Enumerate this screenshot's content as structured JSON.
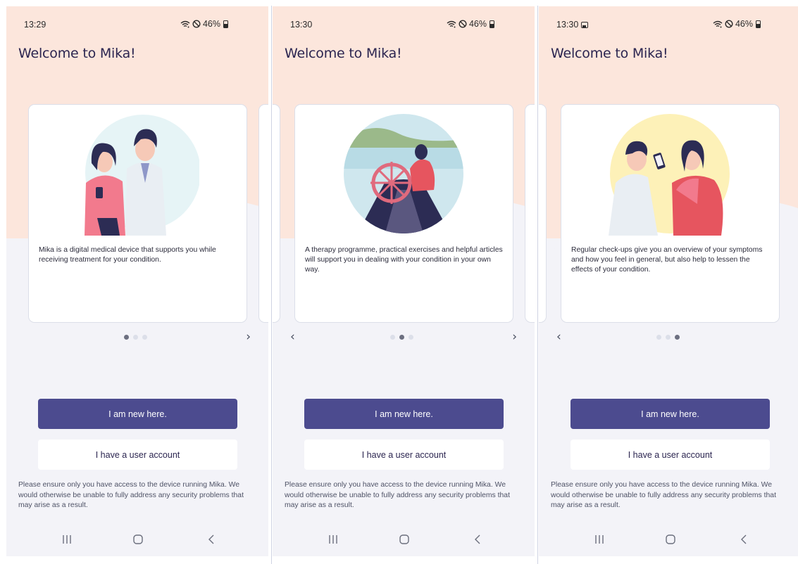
{
  "colors": {
    "peach": "#fce6dc",
    "background": "#f3f3f8",
    "primary_button": "#4c4b8f",
    "title": "#2b2550"
  },
  "screens": [
    {
      "status": {
        "time": "13:29",
        "battery": "46%",
        "icons": [
          "wifi-icon",
          "do-not-disturb-icon",
          "battery-icon"
        ]
      },
      "welcome": "Welcome to Mika!",
      "card": {
        "illustration": "patient-and-doctor-illustration",
        "text": "Mika is a digital medical device that supports you while receiving treatment for your condition."
      },
      "pager": {
        "active": 0,
        "total": 3,
        "has_prev": false,
        "has_next": true
      },
      "buttons": {
        "new": "I am new here.",
        "account": "I have a user account"
      },
      "disclaimer": "Please ensure only you have access to the device running Mika. We would otherwise be unable to fully address any security problems that may arise as a result."
    },
    {
      "status": {
        "time": "13:30",
        "battery": "46%",
        "icons": [
          "wifi-icon",
          "do-not-disturb-icon",
          "battery-icon"
        ]
      },
      "welcome": "Welcome to Mika!",
      "card": {
        "illustration": "ship-wheel-illustration",
        "text": "A therapy programme, practical exercises and helpful articles will support you in dealing with your condition in your own way."
      },
      "pager": {
        "active": 1,
        "total": 3,
        "has_prev": true,
        "has_next": true
      },
      "buttons": {
        "new": "I am new here.",
        "account": "I have a user account"
      },
      "disclaimer": "Please ensure only you have access to the device running Mika. We would otherwise be unable to fully address any security problems that may arise as a result."
    },
    {
      "status": {
        "time": "13:30",
        "battery": "46%",
        "icons": [
          "gallery-icon",
          "wifi-icon",
          "do-not-disturb-icon",
          "battery-icon"
        ]
      },
      "welcome": "Welcome to Mika!",
      "card": {
        "illustration": "doctor-checkup-illustration",
        "text": "Regular check-ups give you an overview of your symptoms and how you feel in general, but also help to lessen the effects of your condition."
      },
      "pager": {
        "active": 2,
        "total": 3,
        "has_prev": true,
        "has_next": false
      },
      "buttons": {
        "new": "I am new here.",
        "account": "I have a user account"
      },
      "disclaimer": "Please ensure only you have access to the device running Mika. We would otherwise be unable to fully address any security problems that may arise as a result."
    }
  ]
}
